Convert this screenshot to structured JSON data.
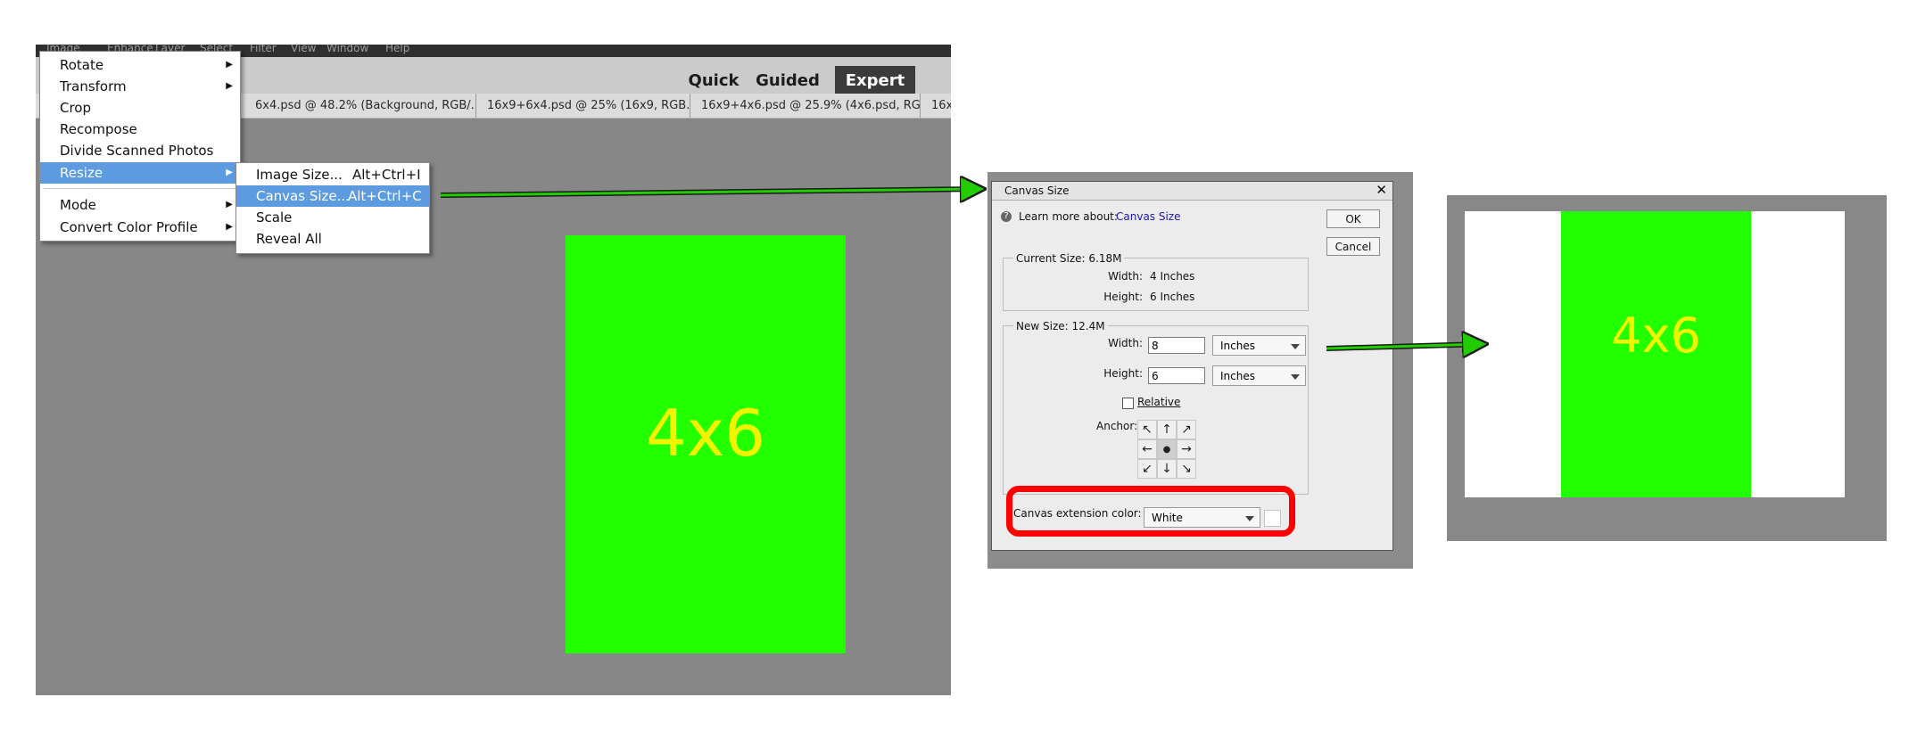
{
  "menubar": {
    "items": [
      "Image",
      "Enhance",
      "Layer",
      "Select",
      "Filter",
      "View",
      "Window",
      "Help"
    ]
  },
  "modes": {
    "quick": "Quick",
    "guided": "Guided",
    "expert": "Expert"
  },
  "doc_tabs": [
    {
      "label": "6x4.psd @ 48.2% (Background, RGB/...",
      "close": "×"
    },
    {
      "label": "16x9+6x4.psd @ 25% (16x9, RGB...",
      "close": "×"
    },
    {
      "label": "16x9+4x6.psd @ 25.9% (4x6.psd, RG...",
      "close": "×"
    },
    {
      "label": "16x",
      "close": ""
    }
  ],
  "image_menu": {
    "items": [
      {
        "label": "Rotate",
        "arrow": "▶"
      },
      {
        "label": "Transform",
        "arrow": "▶"
      },
      {
        "label": "Crop",
        "arrow": ""
      },
      {
        "label": "Recompose",
        "arrow": ""
      },
      {
        "label": "Divide Scanned Photos",
        "arrow": ""
      },
      {
        "label": "Resize",
        "arrow": "▶"
      },
      {
        "label": "Mode",
        "arrow": "▶"
      },
      {
        "label": "Convert Color Profile",
        "arrow": "▶"
      }
    ]
  },
  "resize_menu": {
    "items": [
      {
        "label": "Image Size...",
        "shortcut": "Alt+Ctrl+I"
      },
      {
        "label": "Canvas Size...",
        "shortcut": "Alt+Ctrl+C"
      },
      {
        "label": "Scale",
        "shortcut": ""
      },
      {
        "label": "Reveal All",
        "shortcut": ""
      }
    ]
  },
  "photo": {
    "label": "4x6",
    "color": "#22ff00",
    "text_color": "#f3f300"
  },
  "dialog": {
    "title": "Canvas Size",
    "close": "✕",
    "help_icon": "?",
    "learn_more": "Learn more about:",
    "learn_link": "Canvas Size",
    "ok": "OK",
    "cancel": "Cancel",
    "current_size": {
      "heading": "Current Size: 6.18M",
      "width_label": "Width:",
      "width_value": "4 Inches",
      "height_label": "Height:",
      "height_value": "6 Inches"
    },
    "new_size": {
      "heading": "New Size: 12.4M",
      "width_label": "Width:",
      "width_value": "8",
      "width_unit": "Inches",
      "height_label": "Height:",
      "height_value": "6",
      "height_unit": "Inches",
      "relative_label": "Relative",
      "relative_checked": false,
      "anchor_label": "Anchor:",
      "anchor_grid": [
        "↖",
        "↑",
        "↗",
        "←",
        "●",
        "→",
        "↙",
        "↓",
        "↘"
      ]
    },
    "extension_color_label": "Canvas extension color:",
    "extension_color_value": "White"
  },
  "result": {
    "label": "4x6"
  },
  "colors": {
    "arrow": "#22cc00",
    "highlight": "#ff0000",
    "link": "#1a1aa6"
  }
}
